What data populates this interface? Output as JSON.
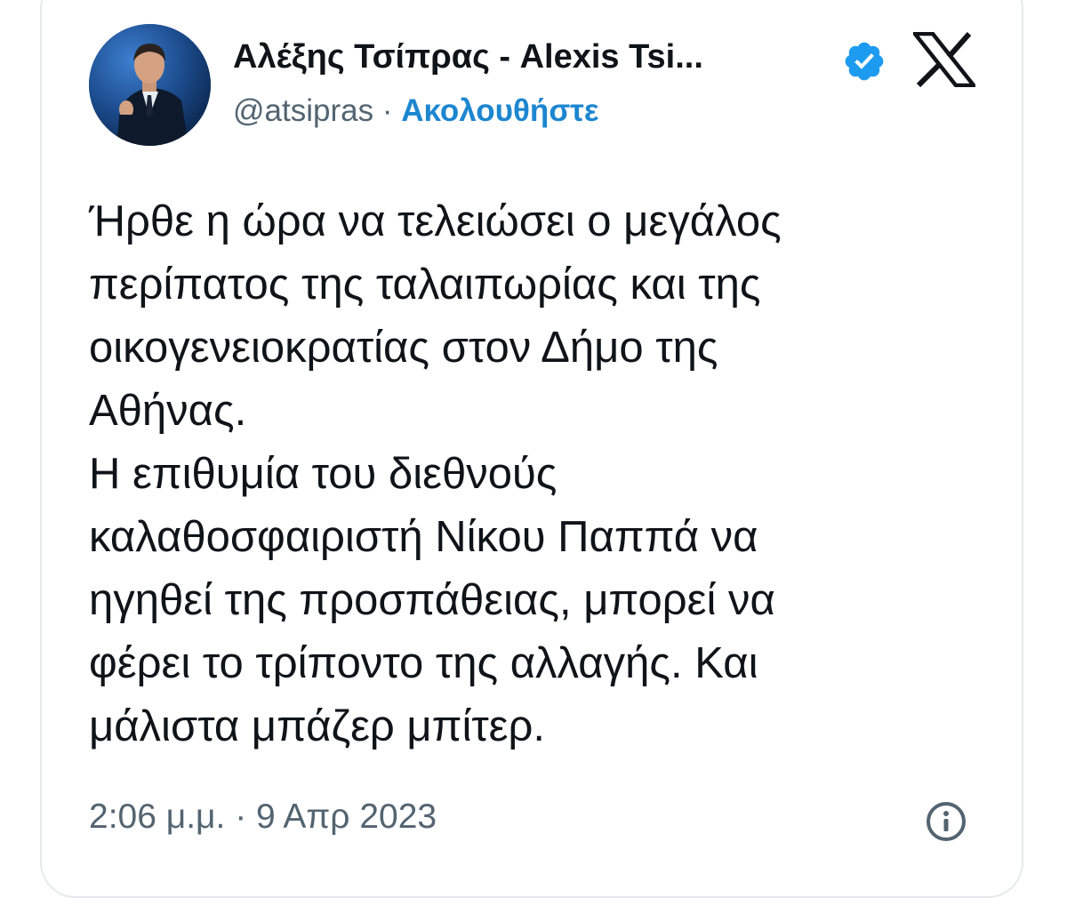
{
  "author": {
    "display_name": "Αλέξης Τσίπρας - Alexis Tsi...",
    "handle": "@atsipras",
    "separator": "·",
    "follow_label": "Ακολουθήστε",
    "verified_icon": "verified-badge-icon",
    "avatar_icon": "profile-photo"
  },
  "platform": {
    "logo_icon": "x-logo-icon"
  },
  "tweet": {
    "lines": [
      "Ήρθε η ώρα να τελειώσει ο μεγάλος",
      "περίπατος της ταλαιπωρίας και της",
      "οικογενειοκρατίας στον Δήμο της",
      "Αθήνας.",
      "Η επιθυμία του διεθνούς",
      "καλαθοσφαιριστή Νίκου Παππά να",
      "ηγηθεί της προσπάθειας, μπορεί να",
      "φέρει το τρίποντο της αλλαγής. Και",
      "μάλιστα μπάζερ μπίτερ."
    ],
    "timestamp": "2:06 μ.μ. · 9 Απρ 2023",
    "info_icon": "info-icon"
  },
  "colors": {
    "text": "#0f1419",
    "secondary": "#536471",
    "link": "#1d86d0",
    "verified": "#1d9bf0",
    "border": "#e6e9ec"
  }
}
